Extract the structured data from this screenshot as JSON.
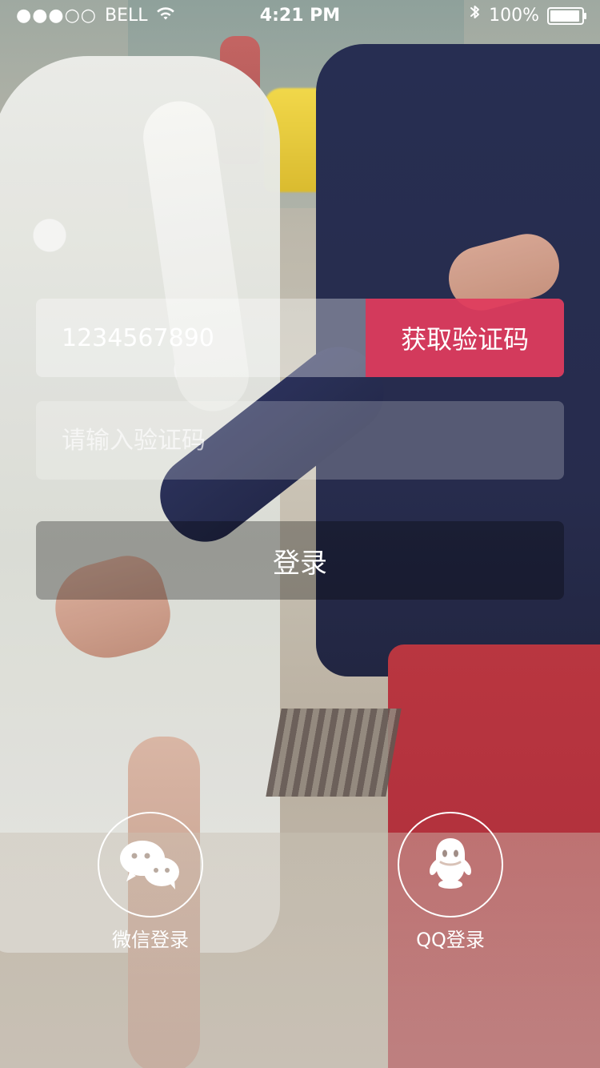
{
  "status_bar": {
    "carrier": "BELL",
    "time": "4:21 PM",
    "battery": "100%"
  },
  "form": {
    "phone_value": "1234567890",
    "get_code_label": "获取验证码",
    "code_placeholder": "请输入验证码",
    "login_label": "登录"
  },
  "social_login": [
    {
      "label": "微信登录",
      "icon": "wechat-icon"
    },
    {
      "label": "QQ登录",
      "icon": "qq-icon"
    }
  ]
}
